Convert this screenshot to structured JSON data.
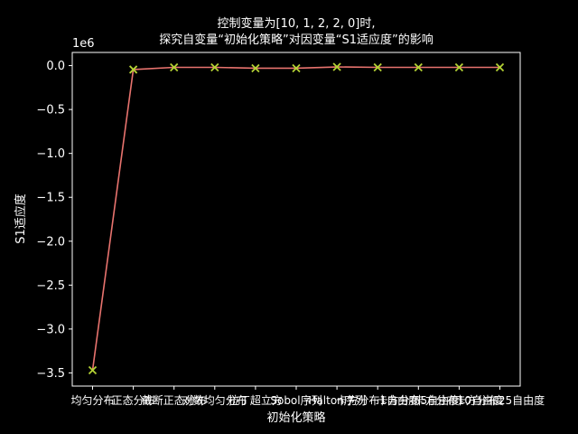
{
  "colors": {
    "background": "#000000",
    "axes": "#ffffff",
    "line": "#e8736e",
    "marker": "#b5d334"
  },
  "chart_data": {
    "type": "line",
    "title_lines": [
      "控制变量为[10, 1, 2, 2, 0]时,",
      "探究自变量“初始化策略”对因变量“S1适应度”的影响"
    ],
    "xlabel": "初始化策略",
    "ylabel": "S1适应度",
    "y_offset_label": "1e6",
    "ylim": [
      -3.65,
      0.15
    ],
    "ylim_unit_note": "",
    "yticks": [
      0.0,
      -0.5,
      -1.0,
      -1.5,
      -2.0,
      -2.5,
      -3.0,
      -3.5
    ],
    "ytick_labels": [
      "0.0",
      "−0.5",
      "−1.0",
      "−1.5",
      "−2.0",
      "−2.5",
      "−3.0",
      "−3.5"
    ],
    "categories": [
      "均匀分布",
      "正态分布",
      "截断正态分布",
      "对数均匀分布",
      "拉丁超立方",
      "Sobol序列",
      "Halton序列",
      "卡方分布1自由度",
      "卡方分布5自由度",
      "卡方分布10自由度",
      "卡方分布25自由度"
    ],
    "series": [
      {
        "values": [
          -3.47,
          -0.045,
          -0.02,
          -0.02,
          -0.03,
          -0.03,
          -0.015,
          -0.02,
          -0.02,
          -0.02,
          -0.02
        ]
      }
    ],
    "grid": false,
    "legend": "none"
  }
}
